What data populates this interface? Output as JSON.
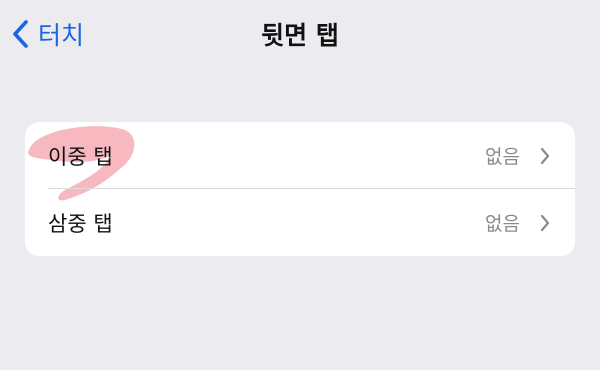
{
  "nav": {
    "back_label": "터치",
    "title": "뒷면 탭"
  },
  "rows": [
    {
      "label": "이중 탭",
      "value": "없음"
    },
    {
      "label": "삼중 탭",
      "value": "없음"
    }
  ],
  "icons": {
    "back": "chevron-left-icon",
    "disclosure": "chevron-right-icon"
  },
  "colors": {
    "accent": "#1a66e0",
    "background": "#ebebf0",
    "card": "#ffffff",
    "secondary_text": "#8a8a8e",
    "marker": "#f4a0ab"
  }
}
